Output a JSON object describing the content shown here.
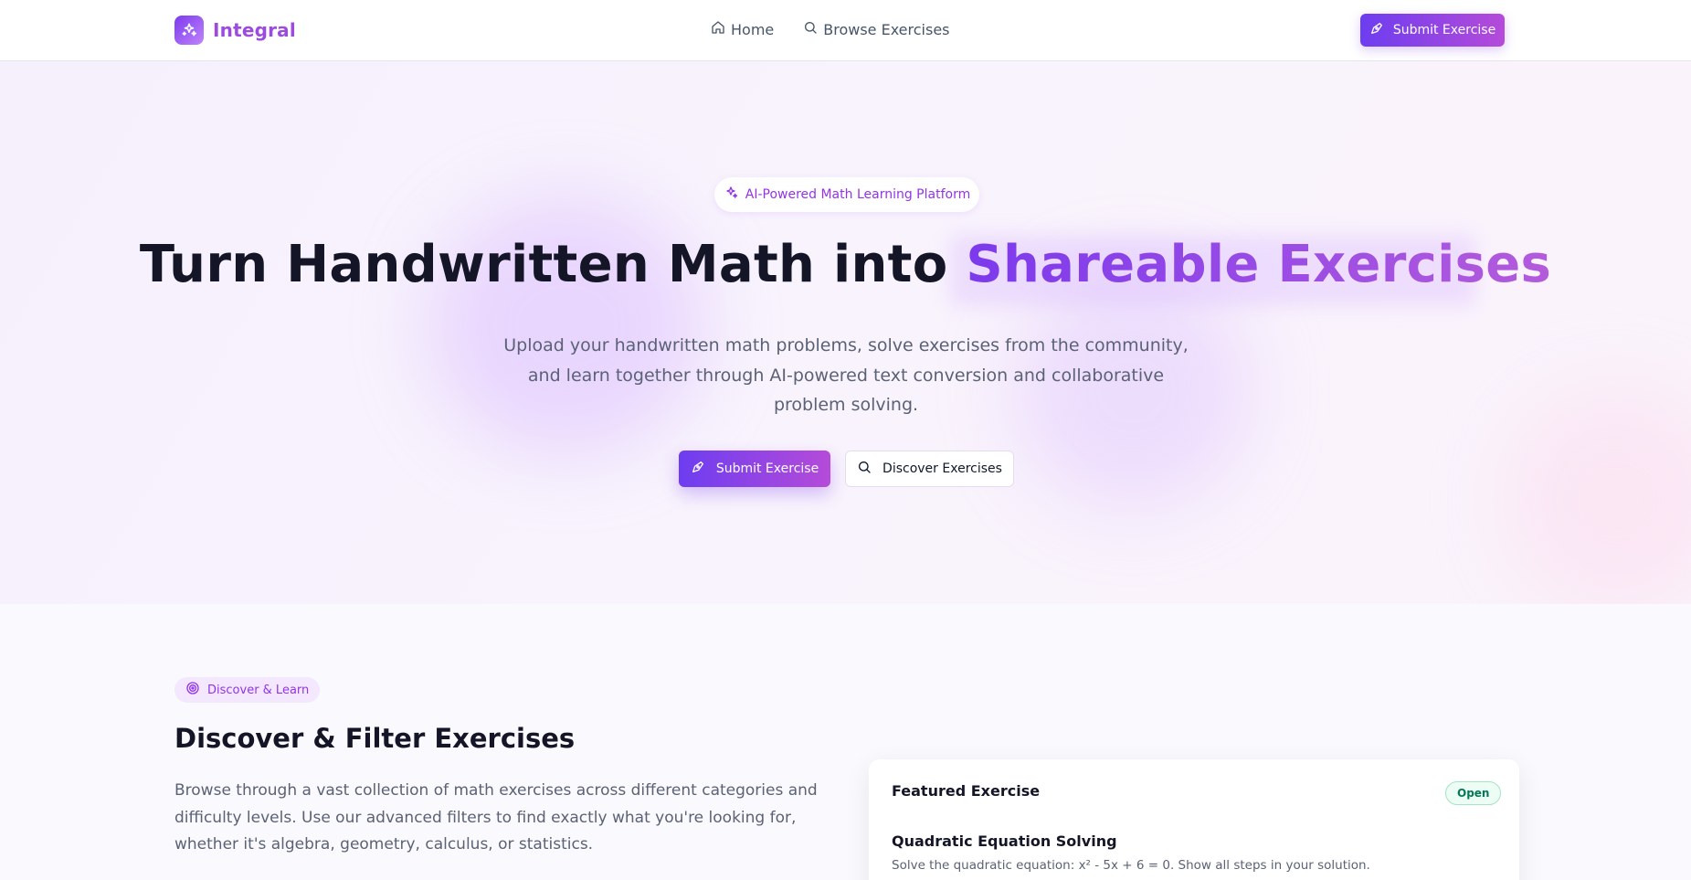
{
  "nav": {
    "logo_text": "Integral",
    "links": [
      {
        "label": "Home",
        "icon": "home-icon"
      },
      {
        "label": "Browse Exercises",
        "icon": "search-icon"
      }
    ],
    "cta_label": "Submit Exercise"
  },
  "hero": {
    "pill_text": "AI-Powered Math Learning Platform",
    "headline_main": "Turn Handwritten Math into ",
    "headline_accent": "Shareable Exercises",
    "subtitle": "Upload your handwritten math problems, solve exercises from the community, and learn together through AI-powered text conversion and collaborative problem solving.",
    "primary_button": "Submit Exercise",
    "secondary_button": "Discover Exercises"
  },
  "discover": {
    "tag": "Discover & Learn",
    "title": "Discover & Filter Exercises",
    "description": "Browse through a vast collection of math exercises across different categories and difficulty levels. Use our advanced filters to find exactly what you're looking for, whether it's algebra, geometry, calculus, or statistics."
  },
  "featured": {
    "label": "Featured Exercise",
    "status": "Open",
    "title": "Quadratic Equation Solving",
    "text": "Solve the quadratic equation: x² - 5x + 6 = 0. Show all steps in your solution."
  },
  "colors": {
    "brand_start": "#6d3df0",
    "brand_end": "#b54bd9",
    "accent_text": "#9333ea",
    "status_green": "#047857"
  }
}
